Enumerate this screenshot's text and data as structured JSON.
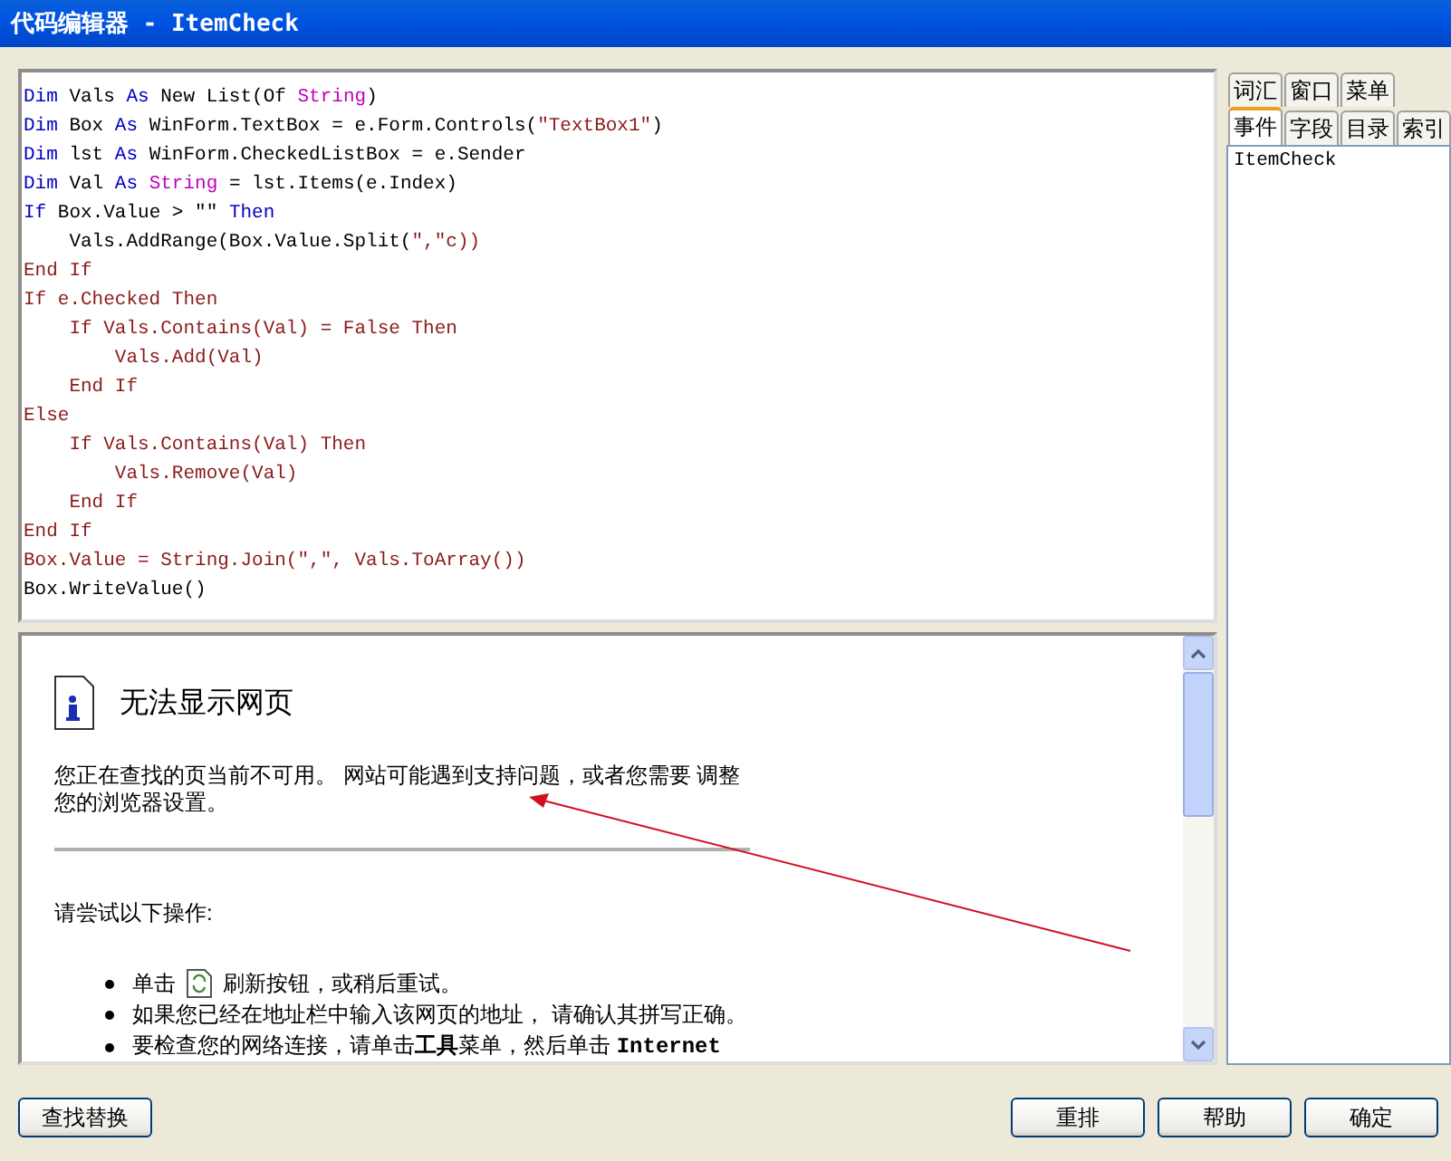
{
  "window": {
    "title": "代码编辑器 - ItemCheck"
  },
  "code_lines": [
    [
      {
        "kind": "kw",
        "text": "Dim"
      },
      {
        "kind": "plain",
        "text": " Vals "
      },
      {
        "kind": "kw",
        "text": "As"
      },
      {
        "kind": "plain",
        "text": " New List(Of "
      },
      {
        "kind": "type",
        "text": "String"
      },
      {
        "kind": "plain",
        "text": ")"
      }
    ],
    [
      {
        "kind": "kw",
        "text": "Dim"
      },
      {
        "kind": "plain",
        "text": " Box "
      },
      {
        "kind": "kw",
        "text": "As"
      },
      {
        "kind": "plain",
        "text": " WinForm.TextBox = e.Form.Controls("
      },
      {
        "kind": "str",
        "text": "\"TextBox1\""
      },
      {
        "kind": "plain",
        "text": ")"
      }
    ],
    [
      {
        "kind": "kw",
        "text": "Dim"
      },
      {
        "kind": "plain",
        "text": " lst "
      },
      {
        "kind": "kw",
        "text": "As"
      },
      {
        "kind": "plain",
        "text": " WinForm.CheckedListBox = e.Sender"
      }
    ],
    [
      {
        "kind": "kw",
        "text": "Dim"
      },
      {
        "kind": "plain",
        "text": " Val "
      },
      {
        "kind": "kw",
        "text": "As "
      },
      {
        "kind": "type",
        "text": "String"
      },
      {
        "kind": "plain",
        "text": " = lst.Items(e.Index)"
      }
    ],
    [
      {
        "kind": "kw",
        "text": "If"
      },
      {
        "kind": "plain",
        "text": " Box.Value > \"\" "
      },
      {
        "kind": "kw",
        "text": "Then"
      }
    ],
    [
      {
        "kind": "plain",
        "text": "    Vals.AddRange(Box.Value.Split("
      },
      {
        "kind": "str",
        "text": "\",\"c))"
      }
    ],
    [
      {
        "kind": "flow",
        "text": "End If"
      }
    ],
    [
      {
        "kind": "flow",
        "text": "If e.Checked Then"
      }
    ],
    [
      {
        "kind": "flow",
        "text": "    If Vals.Contains(Val) = False Then"
      }
    ],
    [
      {
        "kind": "flow",
        "text": "        Vals.Add(Val)"
      }
    ],
    [
      {
        "kind": "flow",
        "text": "    End If"
      }
    ],
    [
      {
        "kind": "flow",
        "text": "Else"
      }
    ],
    [
      {
        "kind": "flow",
        "text": "    If Vals.Contains(Val) Then"
      }
    ],
    [
      {
        "kind": "flow",
        "text": "        Vals.Remove(Val)"
      }
    ],
    [
      {
        "kind": "flow",
        "text": "    End If"
      }
    ],
    [
      {
        "kind": "flow",
        "text": "End If"
      }
    ],
    [
      {
        "kind": "flow",
        "text": "Box.Value = String.Join(\",\", Vals.ToArray())"
      }
    ],
    [
      {
        "kind": "plain",
        "text": "Box.WriteValue()"
      }
    ]
  ],
  "browser": {
    "heading": "无法显示网页",
    "message": "您正在查找的页当前不可用。 网站可能遇到支持问题，或者您需要 调整您的浏览器设置。",
    "try_label": "请尝试以下操作:",
    "bullets": [
      {
        "kind": "refresh",
        "before": "单击",
        "after": "刷新按钮，或稍后重试。"
      },
      {
        "kind": "text",
        "text": "如果您已经在地址栏中输入该网页的地址， 请确认其拼写正确。"
      },
      {
        "kind": "text",
        "text": "要检查您的网络连接，请单击**工具**菜单，然后单击 **Internet**"
      }
    ]
  },
  "side_tabs": {
    "row_1": [
      {
        "label": "词汇",
        "selected": false
      },
      {
        "label": "窗口",
        "selected": false
      },
      {
        "label": "菜单",
        "selected": false
      }
    ],
    "row_2": [
      {
        "label": "事件",
        "selected": true
      },
      {
        "label": "字段",
        "selected": false
      },
      {
        "label": "目录",
        "selected": false
      },
      {
        "label": "索引",
        "selected": false
      }
    ]
  },
  "side_list": [
    "ItemCheck"
  ],
  "buttons_left": [
    "查找替换"
  ],
  "buttons_right": [
    "重排",
    "帮助",
    "确定"
  ]
}
